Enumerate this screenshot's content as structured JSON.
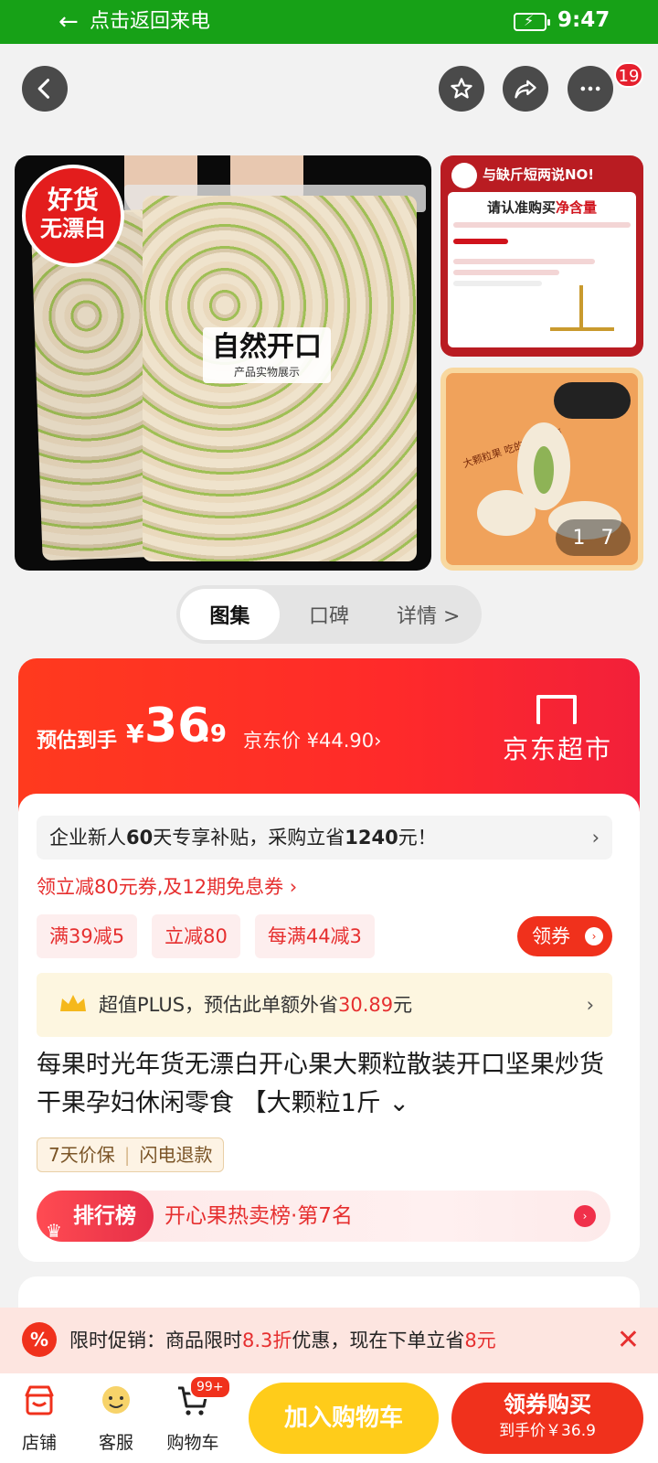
{
  "status_bar": {
    "return_text": "点击返回来电",
    "time": "9:47"
  },
  "top_nav": {
    "notification_count": "19"
  },
  "gallery": {
    "badge_line1": "好货",
    "badge_line2": "无漂白",
    "open_label": "自然开口",
    "open_sub": "产品实物展示",
    "side1_header": "与缺斤短两说NO!",
    "side1_title_a": "请认准购买",
    "side1_title_b": "净含量",
    "side2_text": "大颗粒果 吃的就是过瘾",
    "pager_current": "1",
    "pager_total": "7"
  },
  "tabs": [
    {
      "label": "图集"
    },
    {
      "label": "口碑"
    },
    {
      "label": "详情 >"
    }
  ],
  "price": {
    "est_label": "预估到手",
    "yen": "¥",
    "integer": "36",
    "decimal": ".9",
    "jd_price": "京东价 ¥44.90›",
    "brand": "京东超市"
  },
  "info": {
    "newuser_prefix": "企业新人",
    "newuser_days": "60",
    "newuser_mid": "天专享补贴，采购立省",
    "newuser_amount": "1240",
    "newuser_suffix": "元！",
    "coupon_line": "领立减80元券,及12期免息券 ›",
    "tags": [
      "满39减5",
      "立减80",
      "每满44减3"
    ],
    "get_coupon": "领券",
    "plus_text": "超值PLUS，预估此单额外省",
    "plus_amount": "30.89",
    "plus_unit": "元",
    "title": "每果时光年货无漂白开心果大颗粒散装开口坚果炒货干果孕妇休闲零食 【大颗粒1斤 ⌄",
    "guarantee": [
      "7天价保",
      "闪电退款"
    ],
    "rank_pill": "排行榜",
    "rank_label": "开心果热卖榜·第7名"
  },
  "promo": {
    "prefix": "限时促销：商品限时",
    "discount": "8.3折",
    "mid": "优惠，现在下单立省",
    "save": "8元"
  },
  "bottom": {
    "shop": "店铺",
    "service": "客服",
    "cart": "购物车",
    "cart_badge": "99+",
    "add_cart": "加入购物车",
    "buy_line1": "领券购买",
    "buy_line2": "到手价￥36.9"
  },
  "colors": {
    "status_green": "#17a117",
    "accent_red": "#f0311c",
    "cart_yellow": "#ffcc1a"
  }
}
